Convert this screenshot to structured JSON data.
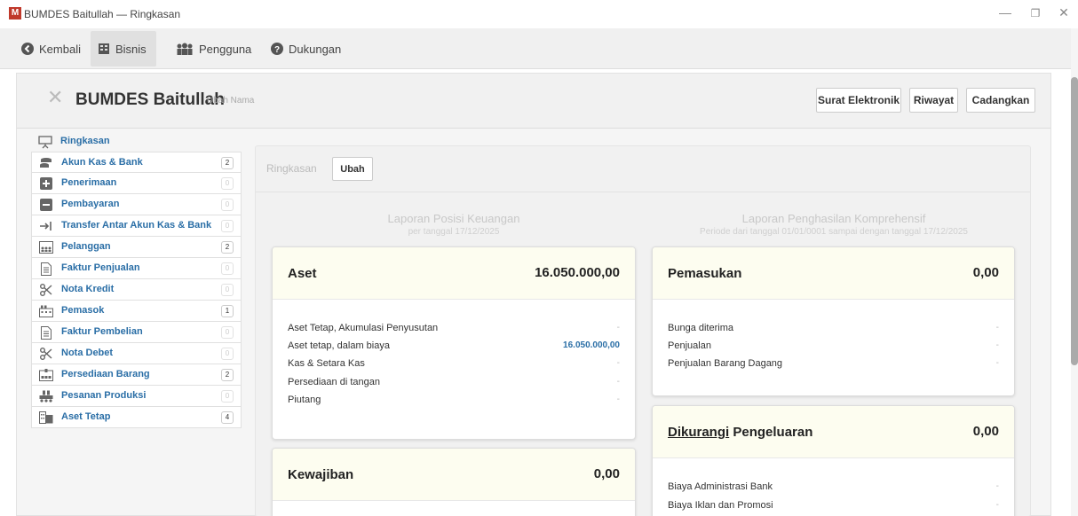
{
  "window": {
    "app_icon_letter": "M",
    "title": "BUMDES Baitullah — Ringkasan",
    "minimize_glyph": "—",
    "restore_glyph": "❐",
    "close_glyph": "✕"
  },
  "topnav": {
    "back": "Kembali",
    "business": "Bisnis",
    "users": "Pengguna",
    "support": "Dukungan"
  },
  "header": {
    "close_glyph": "✕",
    "company_name": "BUMDES Baitullah",
    "rename_link": "Ubah Nama",
    "email_button": "Surat Elektronik",
    "history_button": "Riwayat",
    "backup_button": "Cadangkan"
  },
  "sidebar": {
    "items": [
      {
        "label": "Ringkasan",
        "badge": "",
        "icon": "presentation-icon"
      },
      {
        "label": "Akun Kas & Bank",
        "badge": "2",
        "icon": "coins-icon"
      },
      {
        "label": "Penerimaan",
        "badge": "0",
        "icon": "plus-box-icon"
      },
      {
        "label": "Pembayaran",
        "badge": "0",
        "icon": "minus-box-icon"
      },
      {
        "label": "Transfer Antar Akun Kas & Bank",
        "badge": "0",
        "icon": "transfer-icon"
      },
      {
        "label": "Pelanggan",
        "badge": "2",
        "icon": "customers-icon"
      },
      {
        "label": "Faktur Penjualan",
        "badge": "0",
        "icon": "document-icon"
      },
      {
        "label": "Nota Kredit",
        "badge": "0",
        "icon": "scissors-icon"
      },
      {
        "label": "Pemasok",
        "badge": "1",
        "icon": "factory-icon"
      },
      {
        "label": "Faktur Pembelian",
        "badge": "0",
        "icon": "document-icon"
      },
      {
        "label": "Nota Debet",
        "badge": "0",
        "icon": "scissors-icon"
      },
      {
        "label": "Persediaan Barang",
        "badge": "2",
        "icon": "warehouse-icon"
      },
      {
        "label": "Pesanan Produksi",
        "badge": "0",
        "icon": "production-icon"
      },
      {
        "label": "Aset Tetap",
        "badge": "4",
        "icon": "building-icon"
      }
    ]
  },
  "panel": {
    "breadcrumb": "Ringkasan",
    "edit_button": "Ubah",
    "balance_title": "Laporan Posisi Keuangan",
    "balance_subtitle": "per tanggal 17/12/2025",
    "income_title": "Laporan Penghasilan Komprehensif",
    "income_subtitle": "Periode dari tanggal 01/01/0001 sampai dengan tanggal 17/12/2025"
  },
  "assets": {
    "title": "Aset",
    "total": "16.050.000,00",
    "rows": [
      {
        "label": "Aset Tetap, Akumulasi Penyusutan",
        "value": "-"
      },
      {
        "label": "Aset tetap, dalam biaya",
        "value": "16.050.000,00"
      },
      {
        "label": "Kas & Setara Kas",
        "value": "-"
      },
      {
        "label": "Persediaan di tangan",
        "value": "-"
      },
      {
        "label": "Piutang",
        "value": "-"
      }
    ]
  },
  "liabilities": {
    "title": "Kewajiban",
    "total": "0,00"
  },
  "income": {
    "title": "Pemasukan",
    "total": "0,00",
    "rows": [
      {
        "label": "Bunga diterima",
        "value": "-"
      },
      {
        "label": "Penjualan",
        "value": "-"
      },
      {
        "label": "Penjualan Barang Dagang",
        "value": "-"
      }
    ]
  },
  "expenses": {
    "title_prefix": "Dikurangi",
    "title_suffix": " Pengeluaran",
    "total": "0,00",
    "rows": [
      {
        "label": "Biaya Administrasi Bank",
        "value": "-"
      },
      {
        "label": "Biaya Iklan dan Promosi",
        "value": "-"
      }
    ]
  }
}
